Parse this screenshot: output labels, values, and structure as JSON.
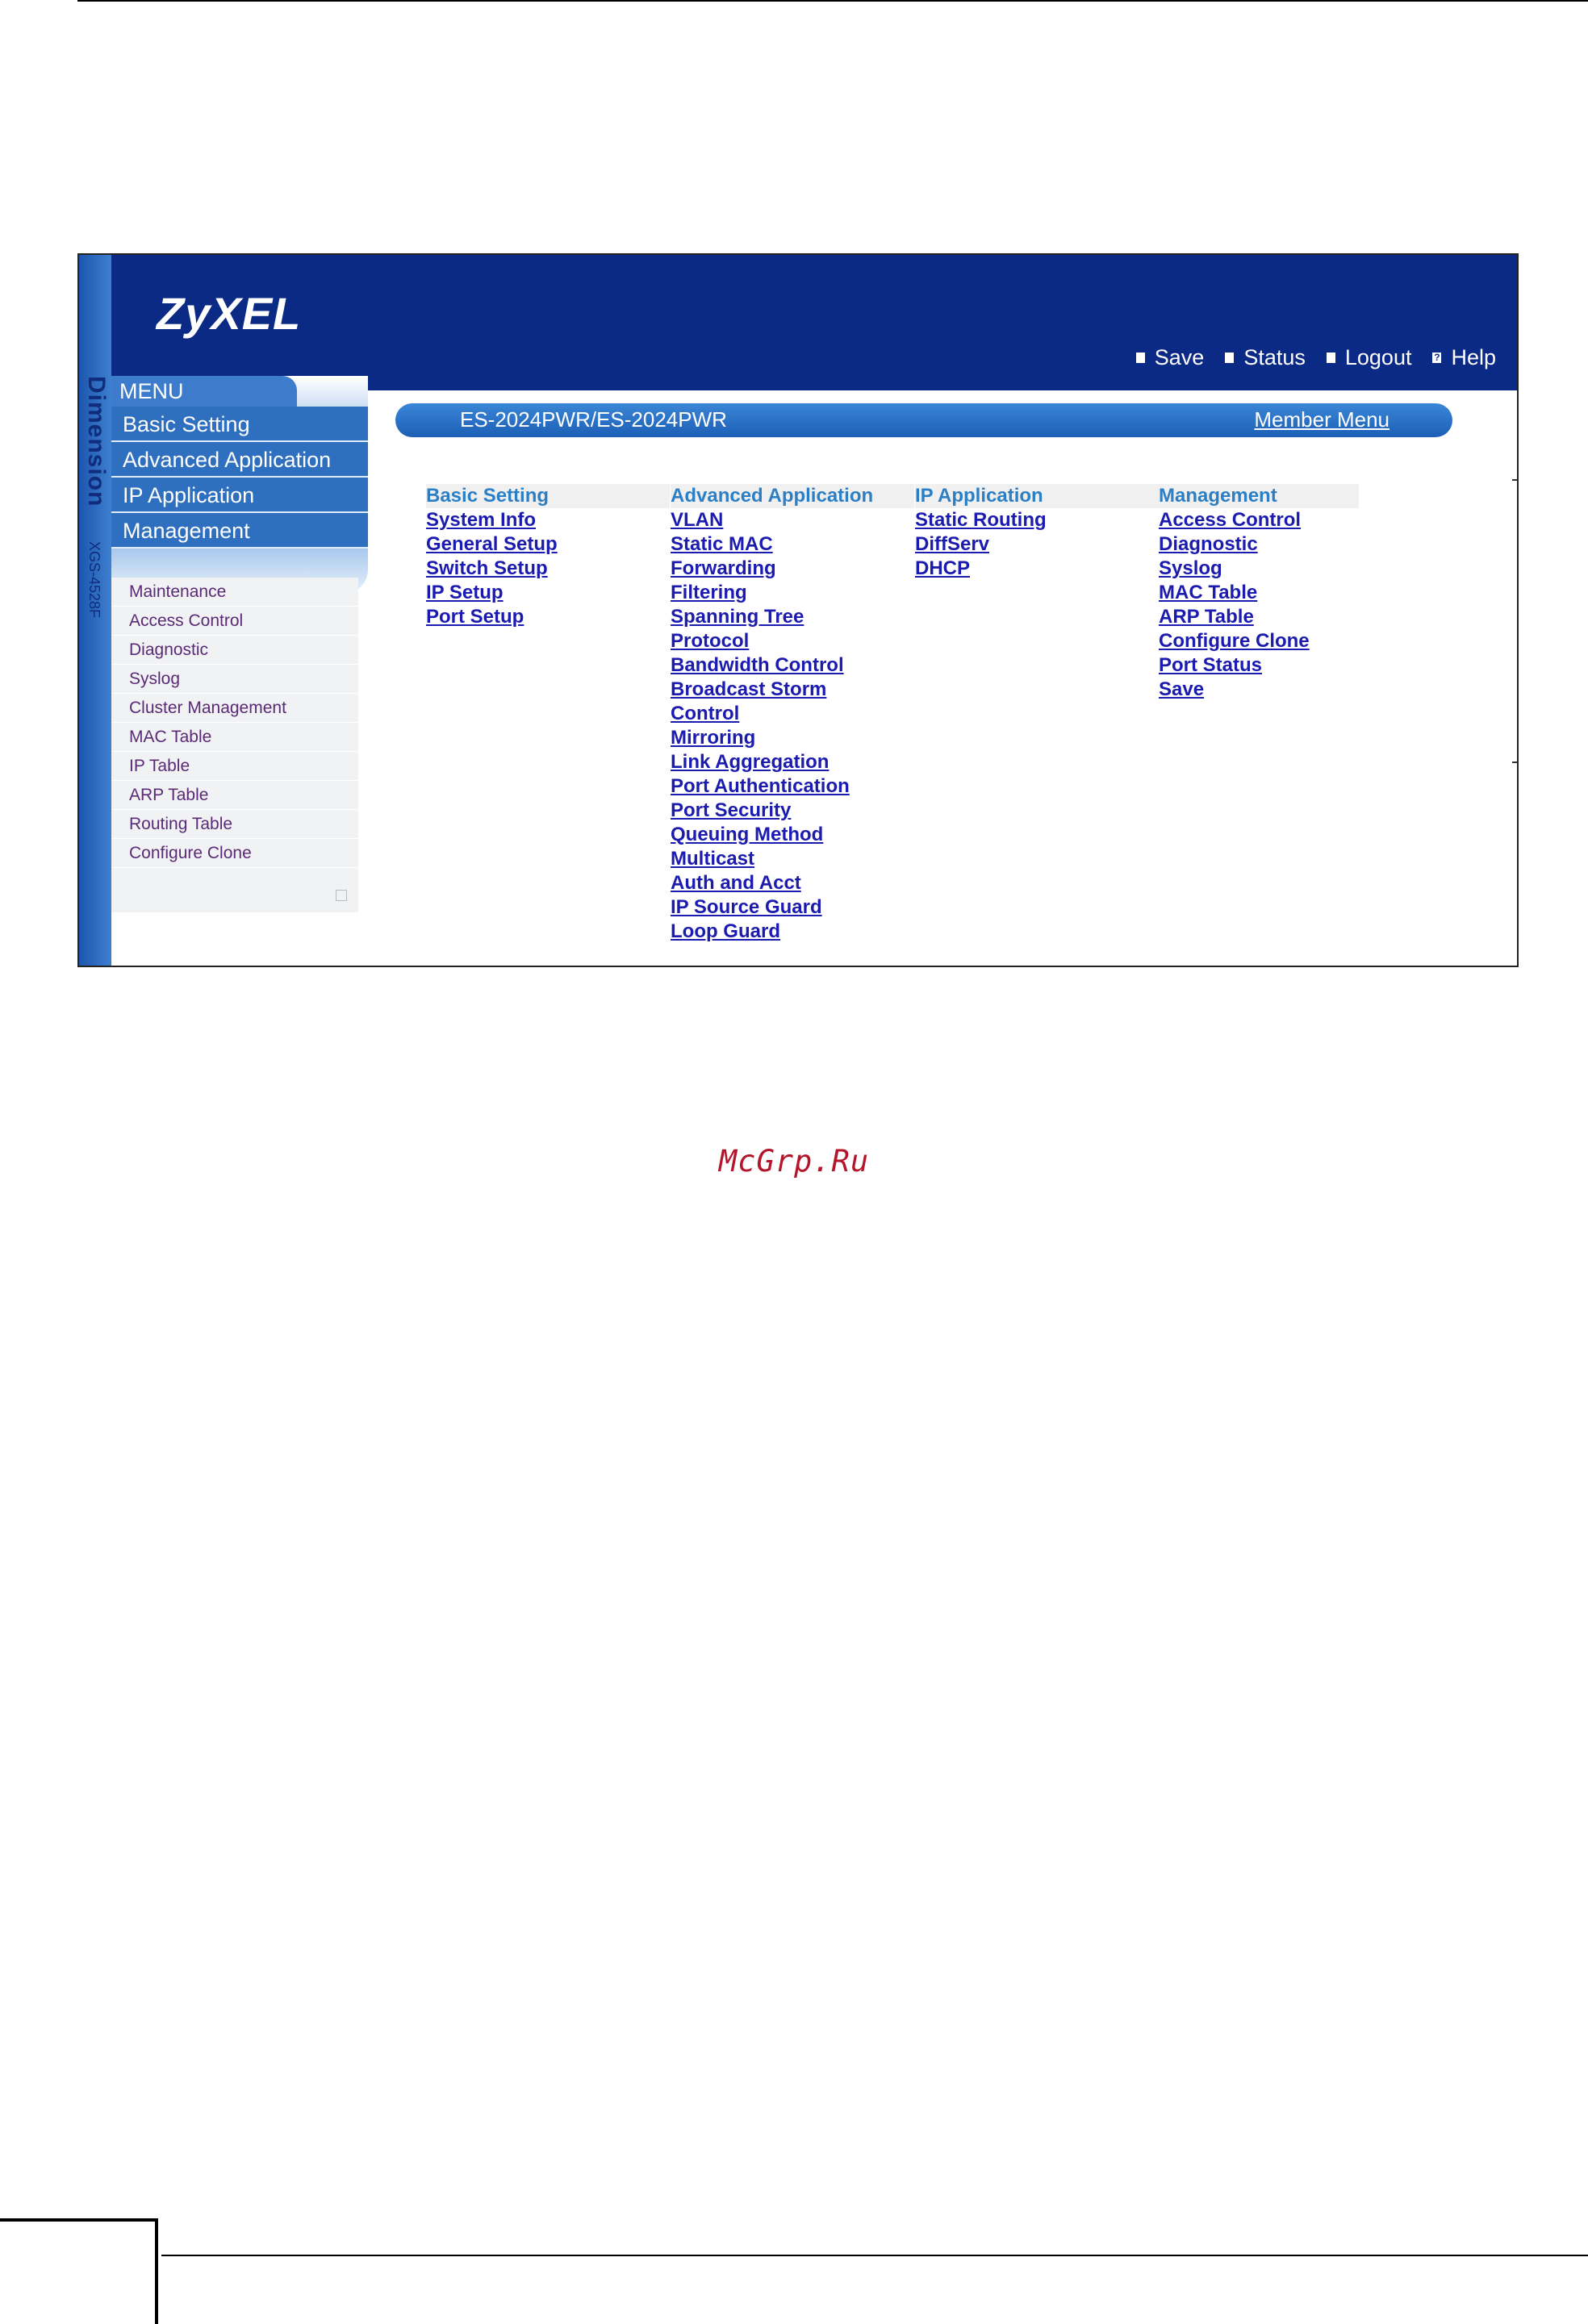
{
  "header": {
    "logo": "ZyXEL",
    "side_brand": "Dimension",
    "side_model": "XGS-4528F",
    "links": [
      {
        "label": "Save",
        "icon": "save-icon",
        "glyph": ""
      },
      {
        "label": "Status",
        "icon": "status-icon",
        "glyph": ""
      },
      {
        "label": "Logout",
        "icon": "logout-icon",
        "glyph": ""
      },
      {
        "label": "Help",
        "icon": "help-icon",
        "glyph": "?"
      }
    ]
  },
  "menu": {
    "title": "MENU",
    "items": [
      "Basic Setting",
      "Advanced Application",
      "IP Application",
      "Management"
    ],
    "submenu": [
      "Maintenance",
      "Access Control",
      "Diagnostic",
      "Syslog",
      "Cluster Management",
      "MAC Table",
      "IP Table",
      "ARP Table",
      "Routing Table",
      "Configure Clone"
    ]
  },
  "content": {
    "title": "ES-2024PWR/ES-2024PWR",
    "member_menu": "Member Menu",
    "columns": [
      {
        "heading": "Basic Setting",
        "links": [
          "System Info",
          "General Setup",
          "Switch Setup",
          "IP Setup",
          "Port Setup"
        ]
      },
      {
        "heading": "Advanced Application",
        "links": [
          "VLAN",
          "Static MAC",
          "Forwarding",
          "Filtering",
          "Spanning Tree",
          "Protocol",
          "Bandwidth Control",
          "Broadcast Storm",
          "Control",
          "Mirroring",
          "Link Aggregation",
          "Port Authentication",
          "Port Security",
          "Queuing Method",
          "Multicast",
          "Auth and Acct",
          "IP Source Guard",
          "Loop Guard"
        ]
      },
      {
        "heading": "IP Application",
        "links": [
          "Static Routing",
          "DiffServ",
          "DHCP"
        ]
      },
      {
        "heading": "Management",
        "links": [
          "Access Control",
          "Diagnostic",
          "Syslog",
          "MAC Table",
          "ARP Table",
          "Configure Clone",
          "Port Status",
          "Save"
        ]
      }
    ]
  },
  "watermark": "McGrp.Ru",
  "colors": {
    "header_bg": "#0b2a85",
    "menu_item_bg": "#2f6fbf",
    "column_heading": "#2c7fc4",
    "link": "#1b1bb0",
    "submenu_text": "#5a2a76",
    "watermark": "#b3152a"
  }
}
